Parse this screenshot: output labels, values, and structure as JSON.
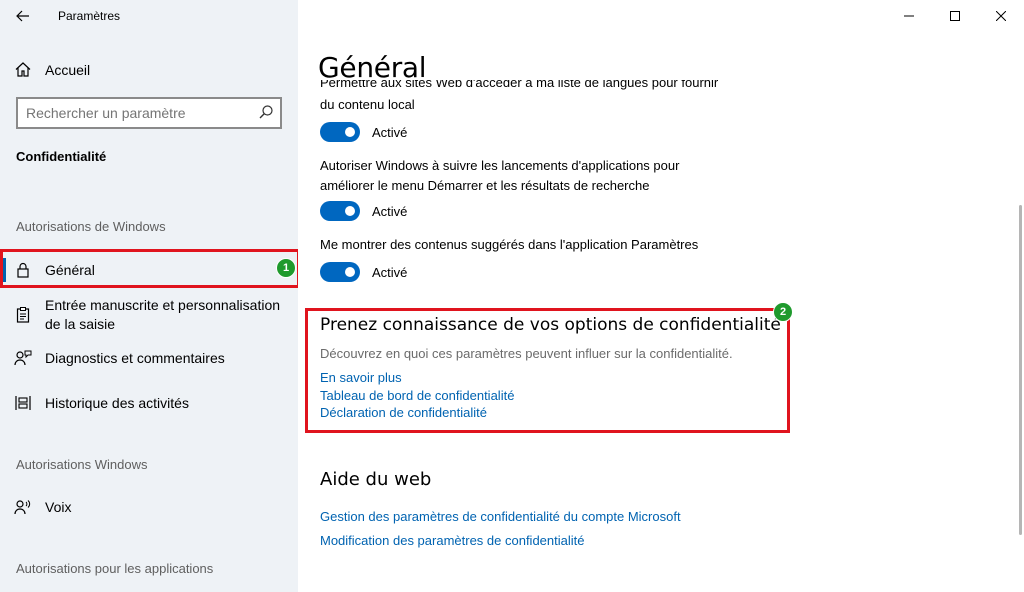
{
  "window": {
    "title": "Paramètres",
    "accent_color": "#0067c0",
    "highlight_color": "#e0141e",
    "badge_color": "#1f9a2d"
  },
  "sidebar": {
    "home_label": "Accueil",
    "search_placeholder": "Rechercher un paramètre",
    "section_heading": "Confidentialité",
    "group1_label": "Autorisations de Windows",
    "items": [
      {
        "label": "Général",
        "icon": "lock-icon",
        "selected": true
      },
      {
        "label": "Entrée manuscrite et personnalisation de la saisie",
        "icon": "clipboard-icon"
      },
      {
        "label": "Diagnostics et commentaires",
        "icon": "feedback-person-icon"
      },
      {
        "label": "Historique des activités",
        "icon": "timeline-icon"
      }
    ],
    "group2_label": "Autorisations Windows",
    "items2": [
      {
        "label": "Voix",
        "icon": "voice-person-icon"
      }
    ],
    "group3_label": "Autorisations pour les applications"
  },
  "badges": {
    "first": "1",
    "second": "2"
  },
  "main": {
    "title": "Général",
    "cut_text": "Permettre aux sites Web d'accéder à ma liste de langues pour fournir",
    "settings": [
      {
        "text_line1": "du contenu local",
        "text_line2": "",
        "state": "Activé",
        "on": true
      },
      {
        "text_line1": "Autoriser Windows à suivre les lancements d'applications pour",
        "text_line2": "améliorer le menu Démarrer et les résultats de recherche",
        "state": "Activé",
        "on": true
      },
      {
        "text_line1": "Me montrer des contenus suggérés dans l'application Paramètres",
        "text_line2": "",
        "state": "Activé",
        "on": true
      }
    ],
    "privacy_options": {
      "title": "Prenez connaissance de vos options de confidentialité",
      "description": "Découvrez en quoi ces paramètres peuvent influer sur la confidentialité.",
      "links": [
        "En savoir plus",
        "Tableau de bord de confidentialité",
        "Déclaration de confidentialité"
      ]
    },
    "web_help": {
      "title": "Aide du web",
      "links": [
        "Gestion des paramètres de confidentialité du compte Microsoft",
        "Modification des paramètres de confidentialité"
      ]
    }
  }
}
